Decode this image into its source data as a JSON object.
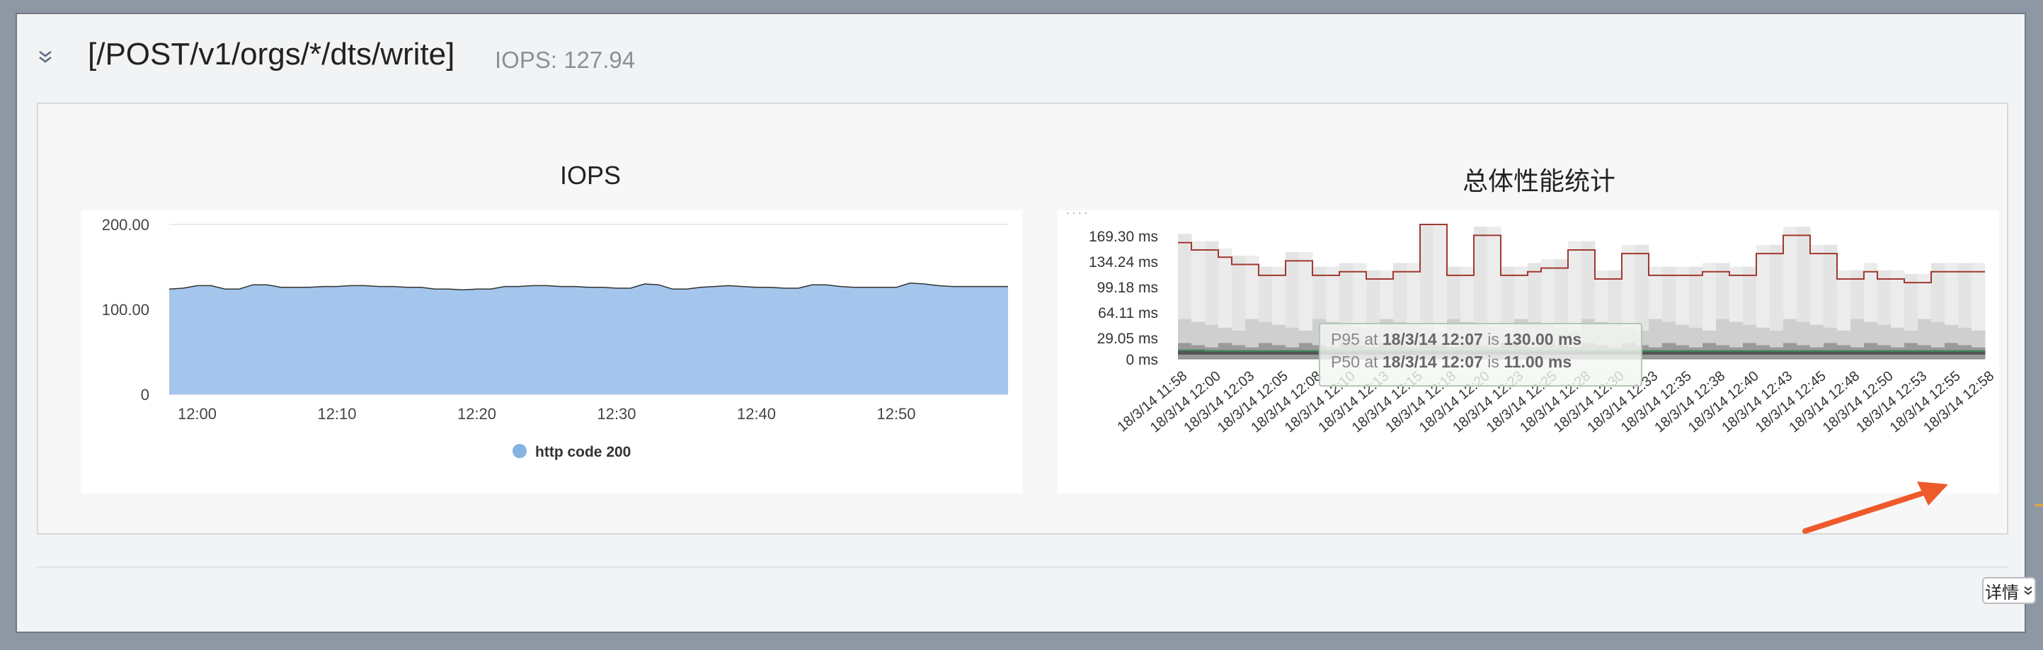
{
  "panel": {
    "title": "[/POST/v1/orgs/*/dts/write]",
    "iops_summary": "IOPS: 127.94"
  },
  "details_button": {
    "label": "详情"
  },
  "chart_data": [
    {
      "type": "area",
      "title": "IOPS",
      "ylim": [
        0,
        200
      ],
      "y_ticks": [
        "200.00",
        "100.00",
        "0"
      ],
      "x_ticks": [
        "12:00",
        "12:10",
        "12:20",
        "12:30",
        "12:40",
        "12:50"
      ],
      "legend_position": "bottom",
      "color": "#a4c6ec",
      "series": [
        {
          "name": "http code 200",
          "x_minutes": [
            -2,
            -1,
            0,
            1,
            2,
            3,
            4,
            5,
            6,
            7,
            8,
            9,
            10,
            11,
            12,
            13,
            14,
            15,
            16,
            17,
            18,
            19,
            20,
            21,
            22,
            23,
            24,
            25,
            26,
            27,
            28,
            29,
            30,
            31,
            32,
            33,
            34,
            35,
            36,
            37,
            38,
            39,
            40,
            41,
            42,
            43,
            44,
            45,
            46,
            47,
            48,
            49,
            50,
            51,
            52,
            53,
            54,
            55,
            56,
            57,
            58
          ],
          "values": [
            124,
            125,
            128,
            128,
            124,
            124,
            129,
            129,
            126,
            126,
            126,
            127,
            127,
            128,
            128,
            127,
            127,
            126,
            126,
            124,
            124,
            123,
            124,
            124,
            127,
            127,
            128,
            128,
            127,
            127,
            126,
            126,
            125,
            125,
            130,
            129,
            124,
            124,
            126,
            127,
            128,
            127,
            126,
            126,
            125,
            125,
            129,
            129,
            127,
            126,
            126,
            126,
            126,
            131,
            130,
            128,
            127,
            127,
            127,
            127,
            127
          ]
        }
      ]
    },
    {
      "type": "heatmap",
      "title": "总体性能统计",
      "y_ticks": [
        "169.30 ms",
        "134.24 ms",
        "99.18 ms",
        "64.11 ms",
        "29.05 ms",
        "0 ms"
      ],
      "ylim": [
        0,
        185
      ],
      "x_ticks": [
        "18/3/14 11:58",
        "18/3/14 12:00",
        "18/3/14 12:03",
        "18/3/14 12:05",
        "18/3/14 12:08",
        "18/3/14 12:10",
        "18/3/14 12:13",
        "18/3/14 12:15",
        "18/3/14 12:18",
        "18/3/14 12:20",
        "18/3/14 12:23",
        "18/3/14 12:25",
        "18/3/14 12:28",
        "18/3/14 12:30",
        "18/3/14 12:33",
        "18/3/14 12:35",
        "18/3/14 12:38",
        "18/3/14 12:40",
        "18/3/14 12:43",
        "18/3/14 12:45",
        "18/3/14 12:48",
        "18/3/14 12:50",
        "18/3/14 12:53",
        "18/3/14 12:55",
        "18/3/14 12:58"
      ],
      "series": [
        {
          "name": "P95",
          "color": "#a0392f",
          "values": [
            160,
            150,
            150,
            140,
            130,
            130,
            115,
            115,
            135,
            135,
            115,
            115,
            120,
            120,
            110,
            110,
            120,
            120,
            185,
            185,
            115,
            115,
            170,
            170,
            115,
            115,
            120,
            125,
            125,
            150,
            150,
            110,
            110,
            145,
            145,
            115,
            115,
            115,
            115,
            120,
            120,
            115,
            115,
            145,
            145,
            170,
            170,
            145,
            145,
            110,
            110,
            120,
            110,
            110,
            105,
            105,
            120,
            120,
            120,
            120
          ]
        },
        {
          "name": "P50",
          "color": "#3e8a5a",
          "values": [
            12,
            12,
            11,
            11,
            11,
            11,
            11,
            11,
            11,
            11,
            11,
            11,
            11,
            11,
            11,
            11,
            11,
            11,
            11,
            11,
            11,
            11,
            11,
            11,
            11,
            11,
            11,
            11,
            11,
            11,
            11,
            11,
            11,
            11,
            11,
            11,
            11,
            11,
            11,
            11,
            11,
            11,
            11,
            11,
            11,
            11,
            11,
            11,
            11,
            11,
            11,
            11,
            11,
            11,
            11,
            11,
            11,
            11,
            11,
            11
          ]
        }
      ],
      "tooltip": {
        "line1": {
          "label": "P95 at",
          "time": "18/3/14 12:07",
          "is": "is",
          "value": "130.00 ms"
        },
        "line2": {
          "label": "P50 at",
          "time": "18/3/14 12:07",
          "is": "is",
          "value": "11.00 ms"
        }
      }
    }
  ]
}
